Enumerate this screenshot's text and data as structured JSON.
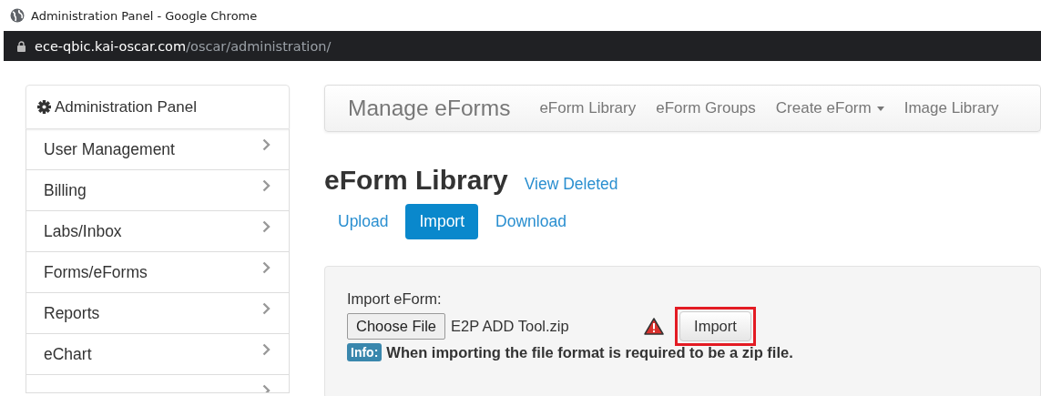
{
  "window": {
    "title": "Administration Panel - Google Chrome"
  },
  "address_bar": {
    "host": "ece-qbic.kai-oscar.com",
    "path": "/oscar/administration/"
  },
  "sidebar": {
    "title": "Administration Panel",
    "items": [
      {
        "label": "User Management"
      },
      {
        "label": "Billing"
      },
      {
        "label": "Labs/Inbox"
      },
      {
        "label": "Forms/eForms"
      },
      {
        "label": "Reports"
      },
      {
        "label": "eChart"
      }
    ],
    "more_below": true
  },
  "navbar": {
    "brand": "Manage eForms",
    "items": [
      {
        "label": "eForm Library",
        "dropdown": false
      },
      {
        "label": "eForm Groups",
        "dropdown": false
      },
      {
        "label": "Create eForm",
        "dropdown": true
      },
      {
        "label": "Image Library",
        "dropdown": false
      }
    ]
  },
  "page": {
    "heading": "eForm Library",
    "heading_link": "View Deleted",
    "tabs": [
      {
        "label": "Upload",
        "selected": false
      },
      {
        "label": "Import",
        "selected": true
      },
      {
        "label": "Download",
        "selected": false
      }
    ]
  },
  "import_form": {
    "label": "Import eForm:",
    "choose_button": "Choose File",
    "file_name": "E2P ADD Tool.zip",
    "warning": true,
    "import_button": "Import",
    "highlighted": true,
    "info_badge": "Info:",
    "info_text": "When importing the file format is required to be a zip file."
  }
}
